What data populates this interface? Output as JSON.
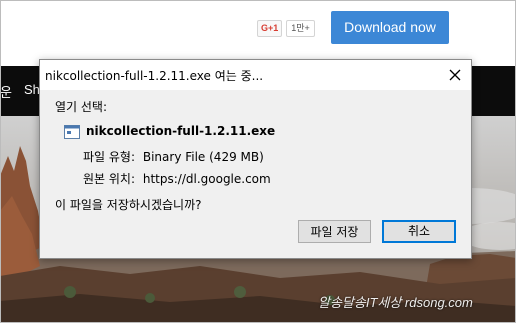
{
  "page": {
    "gplus_label": "G+1",
    "gplus_count": "1만+",
    "download_button": "Download now",
    "nav_items": [
      "운",
      "Sh"
    ],
    "watermark": "알송달송IT세상 rdsong.com"
  },
  "dialog": {
    "title": "nikcollection-full-1.2.11.exe 여는 중...",
    "prompt": "열기 선택:",
    "file_name": "nikcollection-full-1.2.11.exe",
    "file_type_label": "파일 유형:",
    "file_type_value": "Binary File (429 MB)",
    "source_label": "원본 위치:",
    "source_value": "https://dl.google.com",
    "question": "이 파일을 저장하시겠습니까?",
    "save_button": "파일 저장",
    "cancel_button": "취소"
  },
  "colors": {
    "download_button": "#3c87d6",
    "nav_bar": "#0c0c0c",
    "dialog_bg": "#f0f0f0",
    "focus_border": "#0078d7"
  },
  "icons": {
    "close": "close-icon",
    "file": "executable-file-icon"
  }
}
